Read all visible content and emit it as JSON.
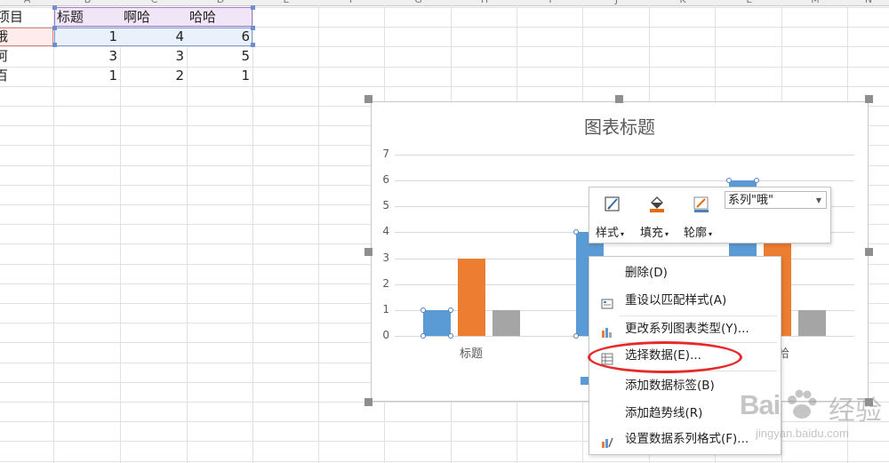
{
  "sheet": {
    "column_headers": [
      "A",
      "B",
      "C",
      "D",
      "E",
      "F",
      "G",
      "H",
      "I",
      "J",
      "K",
      "L",
      "M",
      "N"
    ],
    "header_row": [
      "项目",
      "标题",
      "啊哈",
      "哈哈"
    ],
    "rows": [
      {
        "label": "哦",
        "b": "1",
        "c": "4",
        "d": "6"
      },
      {
        "label": "阿",
        "b": "3",
        "c": "3",
        "d": "5"
      },
      {
        "label": "百",
        "b": "1",
        "c": "2",
        "d": "1"
      }
    ]
  },
  "chart_data": {
    "type": "bar",
    "title": "图表标题",
    "categories": [
      "标题",
      "啊哈",
      "哈哈"
    ],
    "series": [
      {
        "name": "哦",
        "values": [
          1,
          4,
          6
        ],
        "color": "#5b9bd5"
      },
      {
        "name": "阿",
        "values": [
          3,
          3,
          5
        ],
        "color": "#ed7d31"
      },
      {
        "name": "百",
        "values": [
          1,
          2,
          1
        ],
        "color": "#a5a5a5"
      }
    ],
    "ylim": [
      0,
      7
    ],
    "yticks": [
      "0",
      "1",
      "2",
      "3",
      "4",
      "5",
      "6",
      "7"
    ],
    "grid": true,
    "legend": "bottom",
    "selected_series": "哦"
  },
  "minibar": {
    "style_label": "样式",
    "fill_label": "填充",
    "outline_label": "轮廓",
    "series_select": "系列\"哦\""
  },
  "context_menu": {
    "items": [
      {
        "label": "删除(D)",
        "icon": ""
      },
      {
        "label": "重设以匹配样式(A)",
        "icon": "reset-style-icon"
      },
      {
        "label": "更改系列图表类型(Y)...",
        "icon": "chart-type-icon"
      },
      {
        "label": "选择数据(E)...",
        "icon": "select-data-icon"
      },
      {
        "label": "添加数据标签(B)",
        "icon": ""
      },
      {
        "label": "添加趋势线(R)",
        "icon": ""
      },
      {
        "label": "设置数据系列格式(F)...",
        "icon": "format-series-icon"
      }
    ]
  },
  "watermark": {
    "brand": "Bai",
    "brand2": "经验",
    "url": "jingyan.baidu.com"
  },
  "colors": {
    "accent_circle": "#e52a2a"
  }
}
